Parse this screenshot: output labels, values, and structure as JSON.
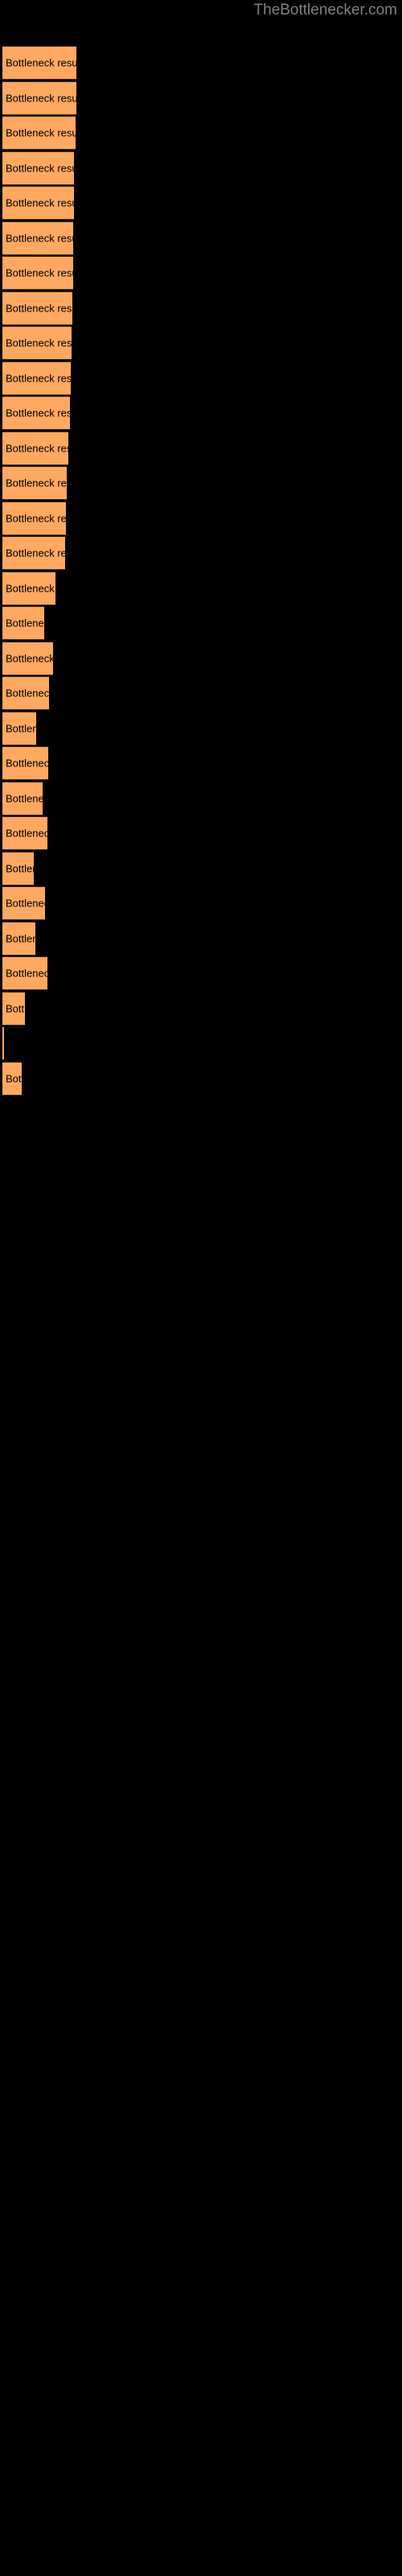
{
  "site": {
    "title": "TheBottlenecker.com"
  },
  "colors": {
    "background": "#000000",
    "bar_fill": "#ffa861",
    "bar_edge": "#3a2414",
    "title_text": "#808080",
    "label_text": "#000000"
  },
  "chart_data": {
    "type": "bar",
    "orientation": "horizontal",
    "title": "",
    "xlabel": "",
    "ylabel": "",
    "grid": false,
    "legend": null,
    "bar_label_text": "Bottleneck result",
    "categories": [
      "Bottleneck result",
      "Bottleneck result",
      "Bottleneck result",
      "Bottleneck result",
      "Bottleneck result",
      "Bottleneck result",
      "Bottleneck result",
      "Bottleneck result",
      "Bottleneck result",
      "Bottleneck result",
      "Bottleneck result",
      "Bottleneck result",
      "Bottleneck result",
      "Bottleneck result",
      "Bottleneck result",
      "Bottleneck result",
      "Bottleneck result",
      "Bottleneck result",
      "Bottleneck result",
      "Bottleneck result",
      "Bottleneck result",
      "Bottleneck result",
      "Bottleneck result",
      "Bottleneck result",
      "Bottleneck result",
      "Bottleneck result",
      "Bottleneck result",
      "Bottleneck result",
      "Bottleneck result",
      "Bottleneck result"
    ],
    "values": [
      92,
      92,
      91,
      89,
      89,
      88,
      88,
      87,
      86,
      85,
      84,
      82,
      80,
      79,
      78,
      66,
      52,
      63,
      58,
      42,
      57,
      50,
      56,
      39,
      53,
      41,
      56,
      28,
      2,
      24
    ],
    "xlim": [
      0,
      100
    ]
  }
}
